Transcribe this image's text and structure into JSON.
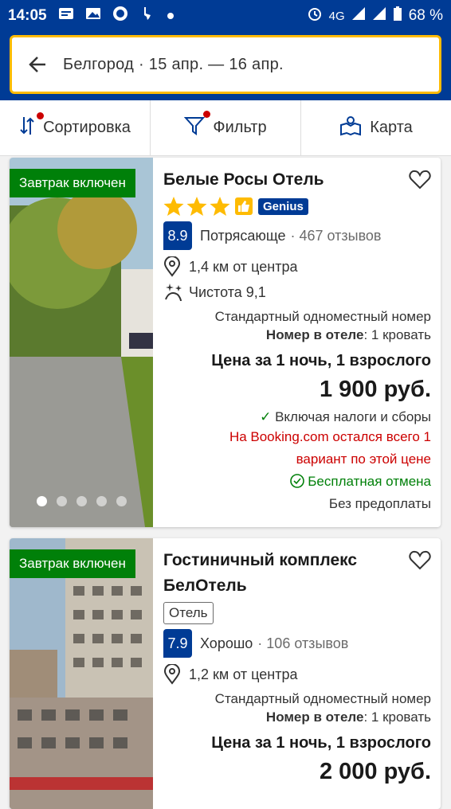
{
  "status": {
    "time": "14:05",
    "network": "4G",
    "battery": "68 %"
  },
  "search": {
    "text": "Белгород · 15 апр. — 16 апр."
  },
  "toolbar": {
    "sort": "Сортировка",
    "filter": "Фильтр",
    "map": "Карта"
  },
  "hotels": [
    {
      "badge": "Завтрак включен",
      "name": "Белые Росы Отель",
      "stars": 3,
      "genius": "Genius",
      "score": "8.9",
      "rating_word": "Потрясающе",
      "reviews": "· 467 отзывов",
      "distance": "1,4 км от центра",
      "cleanliness": "Чистота 9,1",
      "room": "Стандартный одноместный номер",
      "bed_label": "Номер в отеле",
      "bed_value": ": 1 кровать",
      "price_label": "Цена за 1 ночь, 1 взрослого",
      "price": "1 900 руб.",
      "taxes": "Включая налоги и сборы",
      "scarcity_1": "На Booking.com остался всего 1",
      "scarcity_2": "вариант по этой цене",
      "cancellation": "Бесплатная отмена",
      "prepay": "Без предоплаты"
    },
    {
      "badge": "Завтрак включен",
      "name_line1": "Гостиничный комплекс",
      "name_line2": "БелОтель",
      "type": "Отель",
      "score": "7.9",
      "rating_word": "Хорошо",
      "reviews": "· 106 отзывов",
      "distance": "1,2 км от центра",
      "room": "Стандартный одноместный номер",
      "bed_label": "Номер в отеле",
      "bed_value": ": 1 кровать",
      "price_label": "Цена за 1 ночь, 1 взрослого",
      "price": "2 000 руб."
    }
  ],
  "colors": {
    "brand": "#003b95",
    "accent": "#febb02",
    "green": "#008009",
    "red": "#cc0000"
  }
}
